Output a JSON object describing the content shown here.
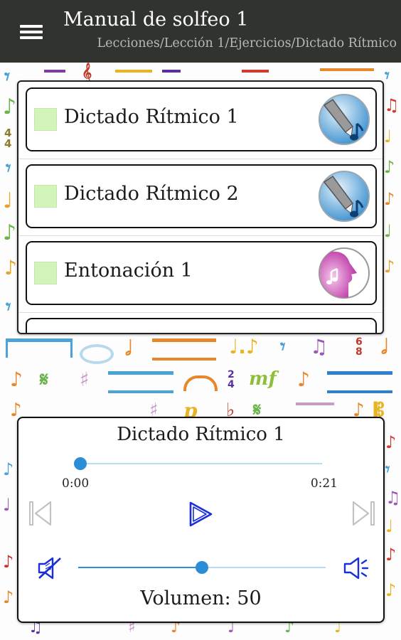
{
  "app_bar": {
    "title": "Manual de solfeo 1",
    "breadcrumb": "Lecciones/Lección 1/Ejercicios/Dictado Rítmico",
    "menu_icon": "menu-icon"
  },
  "lessons": {
    "items": [
      {
        "label": "Dictado Rítmico 1",
        "icon": "pencil-note-icon",
        "completed": false
      },
      {
        "label": "Dictado Rítmico 2",
        "icon": "pencil-note-icon",
        "completed": false
      },
      {
        "label": "Entonación 1",
        "icon": "singing-face-icon",
        "completed": false
      }
    ]
  },
  "player": {
    "track_title": "Dictado Rítmico 1",
    "time_start": "0:00",
    "time_end": "0:21",
    "progress": 0.0,
    "volume_label": "Volumen:",
    "volume_value": "50",
    "volume_level": 0.5,
    "controls": {
      "previous_icon": "skip-previous-icon",
      "play_icon": "play-icon",
      "next_icon": "skip-next-icon",
      "mute_icon": "volume-mute-icon",
      "volume_icon": "volume-up-icon"
    }
  },
  "colors": {
    "app_bar": "#31332f",
    "accent": "#2a8dd5",
    "play_icon": "#1a2fd9",
    "check": "#d3f4ba"
  }
}
